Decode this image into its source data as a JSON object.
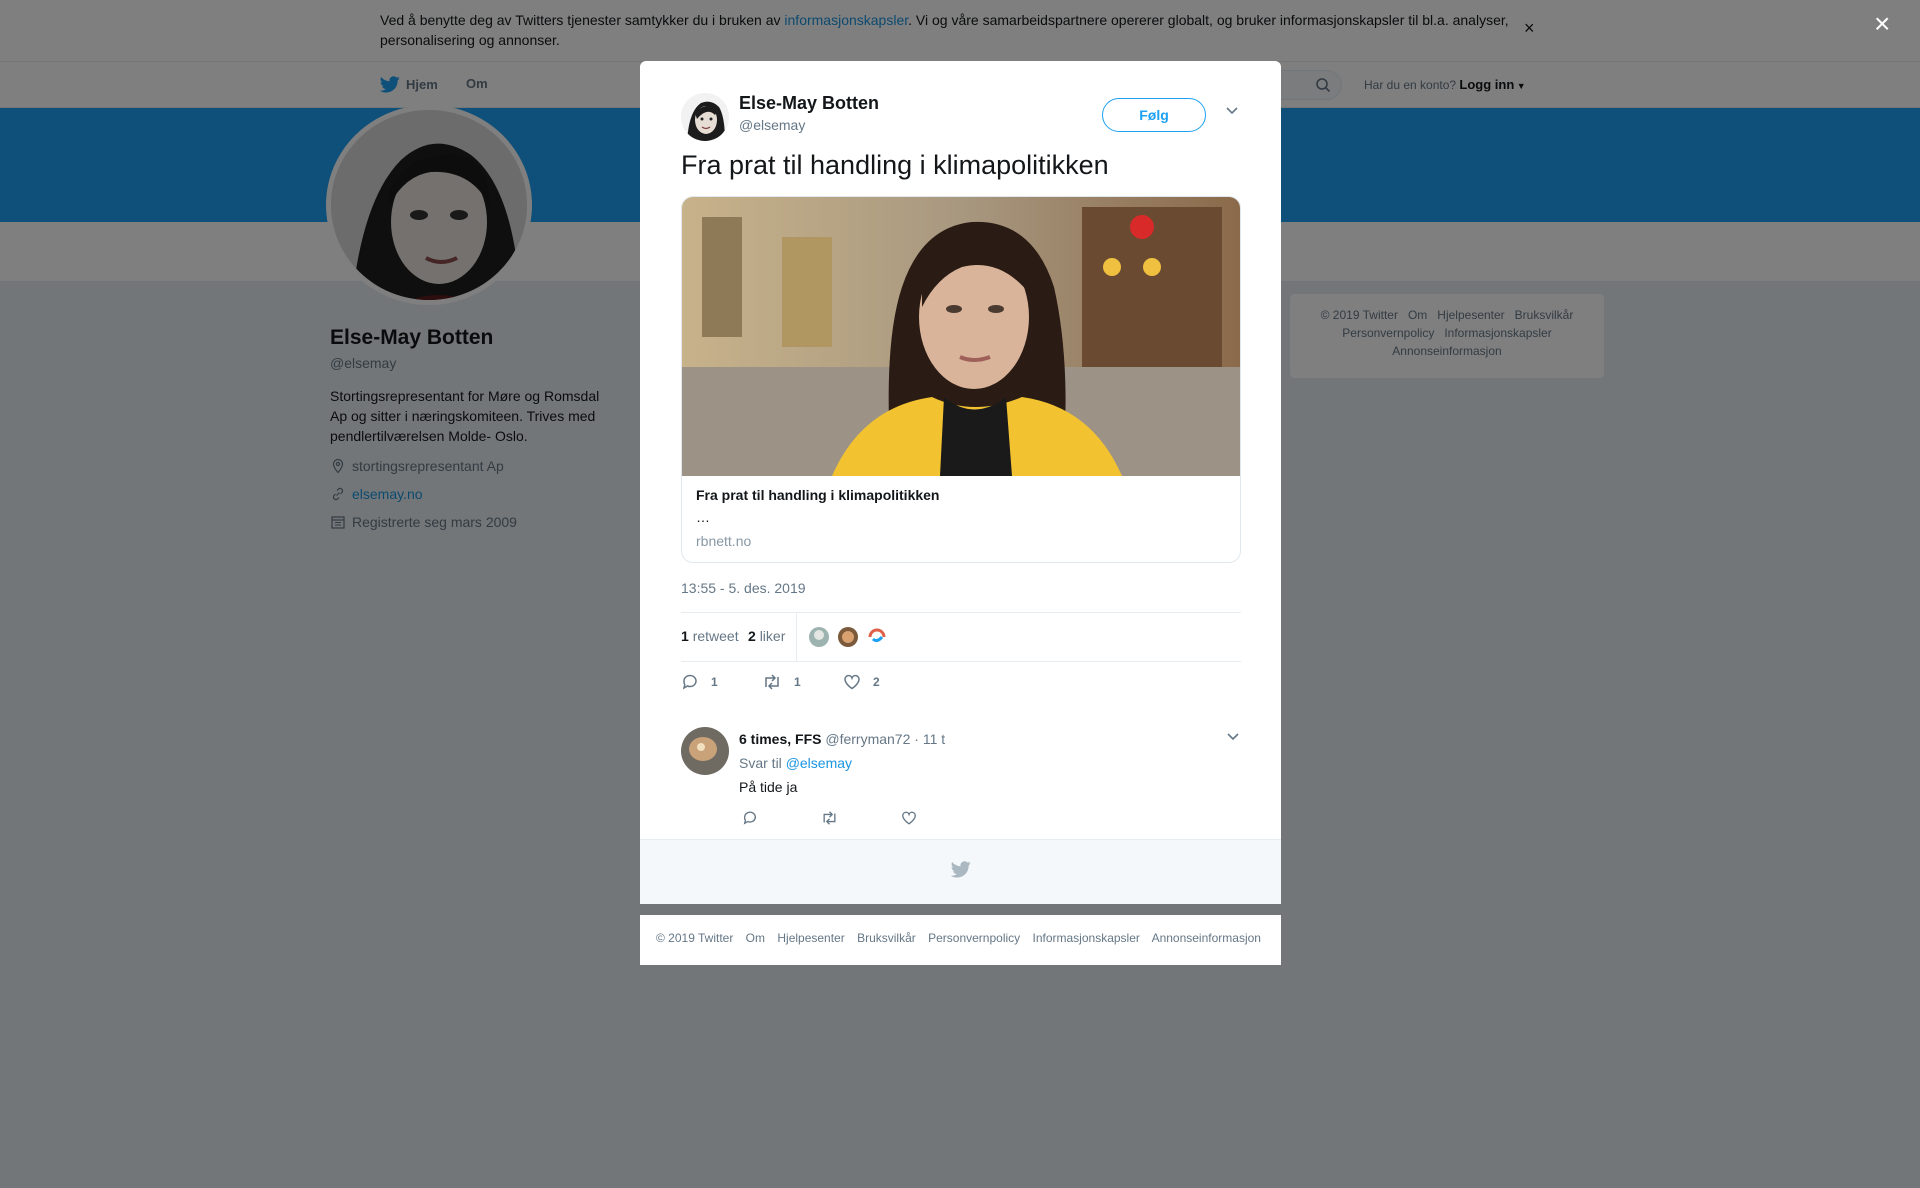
{
  "cookie_banner": {
    "text_before": "Ved å benytte deg av Twitters tjenester samtykker du i bruken av ",
    "link": "informasjonskapsler",
    "text_after": ". Vi og våre samarbeidspartnere opererer globalt, og bruker informasjonskapsler til bl.a. analyser, personalisering og annonser.",
    "close": "×"
  },
  "topnav": {
    "home": "Hjem",
    "about": "Om",
    "have_account": "Har du en konto?",
    "login": "Logg inn"
  },
  "profile": {
    "name": "Else-May Botten",
    "handle": "@elsemay",
    "bio": "Stortingsrepresentant for Møre og Romsdal Ap og sitter i næringskomiteen. Trives med pendlertilværelsen Molde- Oslo.",
    "location": "stortingsrepresentant Ap",
    "website": "elsemay.no",
    "joined": "Registrerte seg mars 2009"
  },
  "side_footer": [
    "© 2019 Twitter",
    "Om",
    "Hjelpesenter",
    "Bruksvilkår",
    "Personvernpolicy",
    "Informasjonskapsler",
    "Annonseinformasjon"
  ],
  "overlay_close": "×",
  "tweet": {
    "author_name": "Else-May Botten",
    "author_handle": "@elsemay",
    "follow": "Følg",
    "text": "Fra prat til handling i klimapolitikken",
    "card": {
      "title": "Fra prat til handling i klimapolitikken",
      "description": "…",
      "domain": "rbnett.no"
    },
    "timestamp": "13:55 - 5. des. 2019",
    "retweets_count": "1",
    "retweets_label": "retweet",
    "likes_count": "2",
    "likes_label": "liker",
    "reply_action_count": "1",
    "retweet_action_count": "1",
    "like_action_count": "2"
  },
  "reply": {
    "name": "6 times, FFS",
    "handle": "@ferryman72",
    "time": "· 11 t",
    "reply_to_label": "Svar til",
    "reply_to_handle": "@elsemay",
    "text": "På tide ja"
  },
  "bottom_links": [
    "© 2019 Twitter",
    "Om",
    "Hjelpesenter",
    "Bruksvilkår",
    "Personvernpolicy",
    "Informasjonskapsler",
    "Annonseinformasjon"
  ],
  "colors": {
    "twitter_blue": "#1da1f2",
    "link_blue": "#1b95e0",
    "text_gray": "#657786"
  }
}
